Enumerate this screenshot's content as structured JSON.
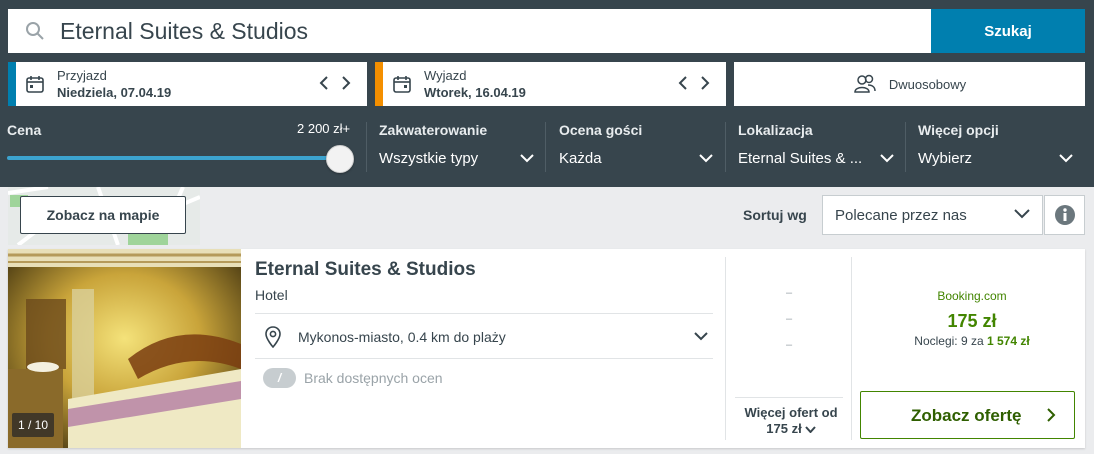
{
  "search": {
    "query": "Eternal Suites & Studios",
    "button": "Szukaj"
  },
  "checkin": {
    "label": "Przyjazd",
    "value": "Niedziela, 07.04.19",
    "accent": "#007faf"
  },
  "checkout": {
    "label": "Wyjazd",
    "value": "Wtorek, 16.04.19",
    "accent": "#f48f00"
  },
  "room": {
    "label": "Dwuosobowy"
  },
  "filters": {
    "price": {
      "label": "Cena",
      "value": "2 200 zł+"
    },
    "accommodation": {
      "label": "Zakwaterowanie",
      "value": "Wszystkie typy"
    },
    "rating": {
      "label": "Ocena gości",
      "value": "Każda"
    },
    "location": {
      "label": "Lokalizacja",
      "value": "Eternal Suites & ..."
    },
    "more": {
      "label": "Więcej opcji",
      "value": "Wybierz"
    }
  },
  "map": {
    "button": "Zobacz na mapie"
  },
  "sort": {
    "label": "Sortuj wg",
    "value": "Polecane przez nas"
  },
  "hotel": {
    "name": "Eternal Suites & Studios",
    "type": "Hotel",
    "location": "Mykonos-miasto, 0.4 km do plaży",
    "rating_badge": "/",
    "rating_text": "Brak dostępnych ocen",
    "image_counter": "1 / 10",
    "dashes": [
      "–",
      "–",
      "–"
    ],
    "more_offers_line1": "Więcej ofert od",
    "more_offers_line2": "175 zł",
    "provider": "Booking.com",
    "price": "175 zł",
    "nights_prefix": "Noclegi: 9 za",
    "nights_total": "1 574 zł",
    "offer_button": "Zobacz ofertę"
  },
  "colors": {
    "topbar": "#37454d",
    "accent_blue": "#007faf",
    "accent_orange": "#f48f00",
    "price_green": "#428500"
  }
}
